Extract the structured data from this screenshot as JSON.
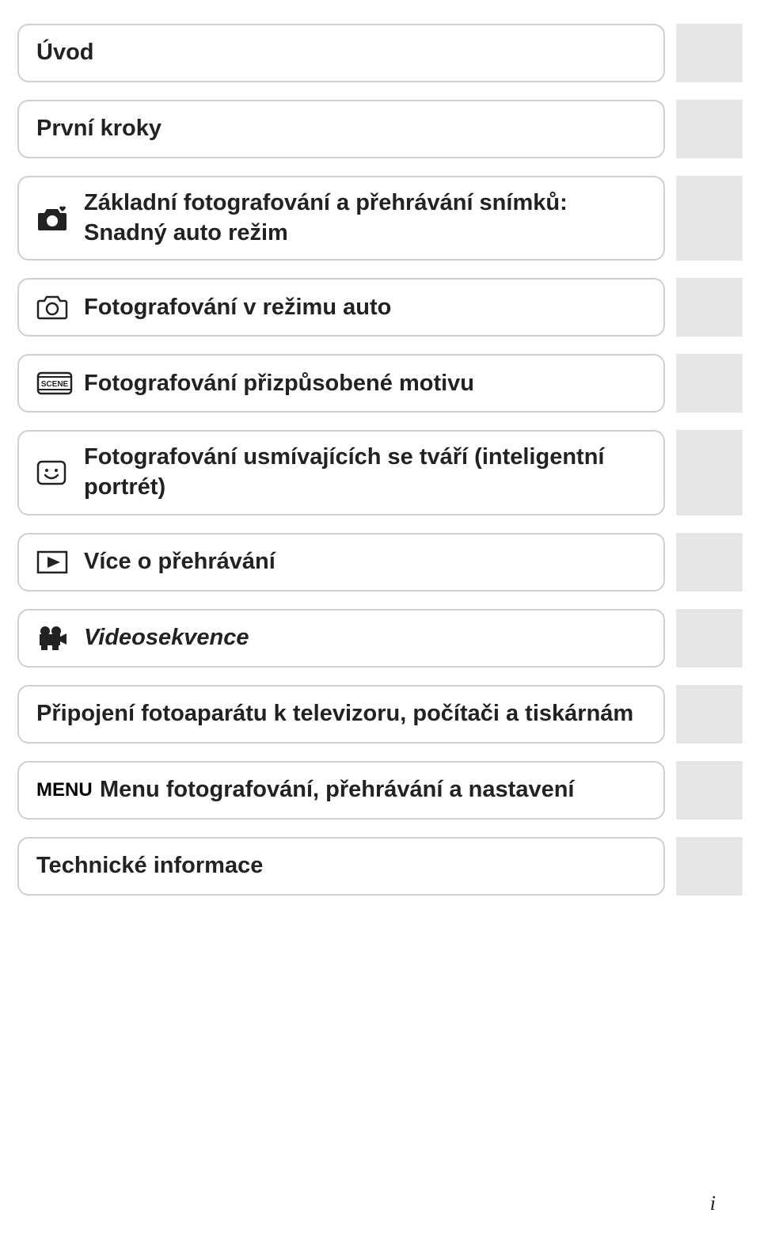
{
  "items": [
    {
      "label": "Úvod"
    },
    {
      "label": "První kroky"
    },
    {
      "label": "Základní fotografování a přehrávání snímků: Snadný auto režim"
    },
    {
      "label": "Fotografování v režimu auto"
    },
    {
      "label": "Fotografování přizpůsobené motivu"
    },
    {
      "label": "Fotografování usmívajících se tváří (inteligentní portrét)"
    },
    {
      "label": "Více o přehrávání"
    },
    {
      "label": "Videosekvence",
      "italic": true
    },
    {
      "label": "Připojení fotoaparátu k televizoru, počítači a tiskárnám"
    },
    {
      "label": "Menu fotografování, přehrávání a nastavení"
    },
    {
      "label": "Technické informace"
    }
  ],
  "icons": {
    "menu_text": "MENU",
    "scene_text": "SCENE"
  },
  "page_number": "i"
}
